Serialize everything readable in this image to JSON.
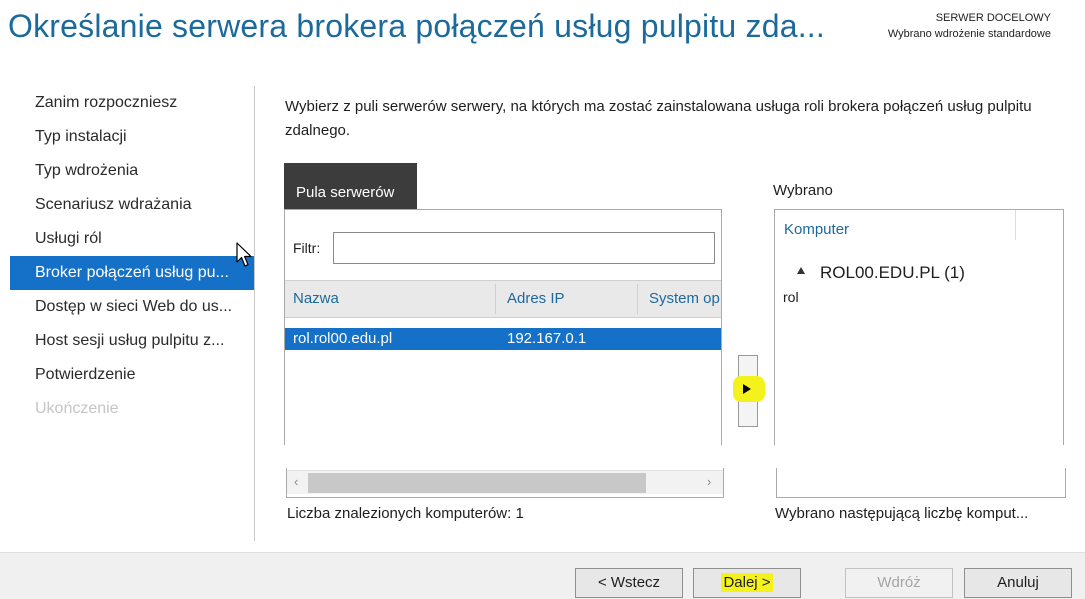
{
  "header": {
    "title": "Określanie serwera brokera połączeń usług pulpitu zda...",
    "target_label": "SERWER DOCELOWY",
    "target_value": "Wybrano wdrożenie standardowe"
  },
  "nav": {
    "items": [
      {
        "label": "Zanim rozpoczniesz",
        "state": "normal"
      },
      {
        "label": "Typ instalacji",
        "state": "normal"
      },
      {
        "label": "Typ wdrożenia",
        "state": "normal"
      },
      {
        "label": "Scenariusz wdrażania",
        "state": "normal"
      },
      {
        "label": "Usługi ról",
        "state": "normal"
      },
      {
        "label": "Broker połączeń usług pu...",
        "state": "selected"
      },
      {
        "label": "Dostęp w sieci Web do us...",
        "state": "normal"
      },
      {
        "label": "Host sesji usług pulpitu z...",
        "state": "normal"
      },
      {
        "label": "Potwierdzenie",
        "state": "normal"
      },
      {
        "label": "Ukończenie",
        "state": "disabled"
      }
    ]
  },
  "main": {
    "instructions": "Wybierz z puli serwerów serwery, na których ma zostać zainstalowana usługa roli brokera połączeń usług pulpitu zdalnego.",
    "pool": {
      "tab_label": "Pula serwerów",
      "filter_label": "Filtr:",
      "filter_value": "",
      "columns": [
        "Nazwa",
        "Adres IP",
        "System op"
      ],
      "rows": [
        {
          "name": "rol.rol00.edu.pl",
          "ip": "192.167.0.1",
          "os": ""
        }
      ],
      "found_count": "Liczba znalezionych komputerów: 1"
    },
    "move_button_icon": "right-arrow-icon",
    "selected": {
      "title": "Wybrano",
      "column": "Komputer",
      "group_label": "ROL00.EDU.PL (1)",
      "items": [
        "rol"
      ],
      "count_text": "Wybrano następującą liczbę komput..."
    }
  },
  "footer": {
    "back": "< Wstecz",
    "next": "Dalej >",
    "deploy": "Wdróż",
    "cancel": "Anuluj"
  },
  "colors": {
    "accent": "#1471c7",
    "title_blue": "#1c6a9c",
    "highlight_yellow": "#f4f21d"
  }
}
